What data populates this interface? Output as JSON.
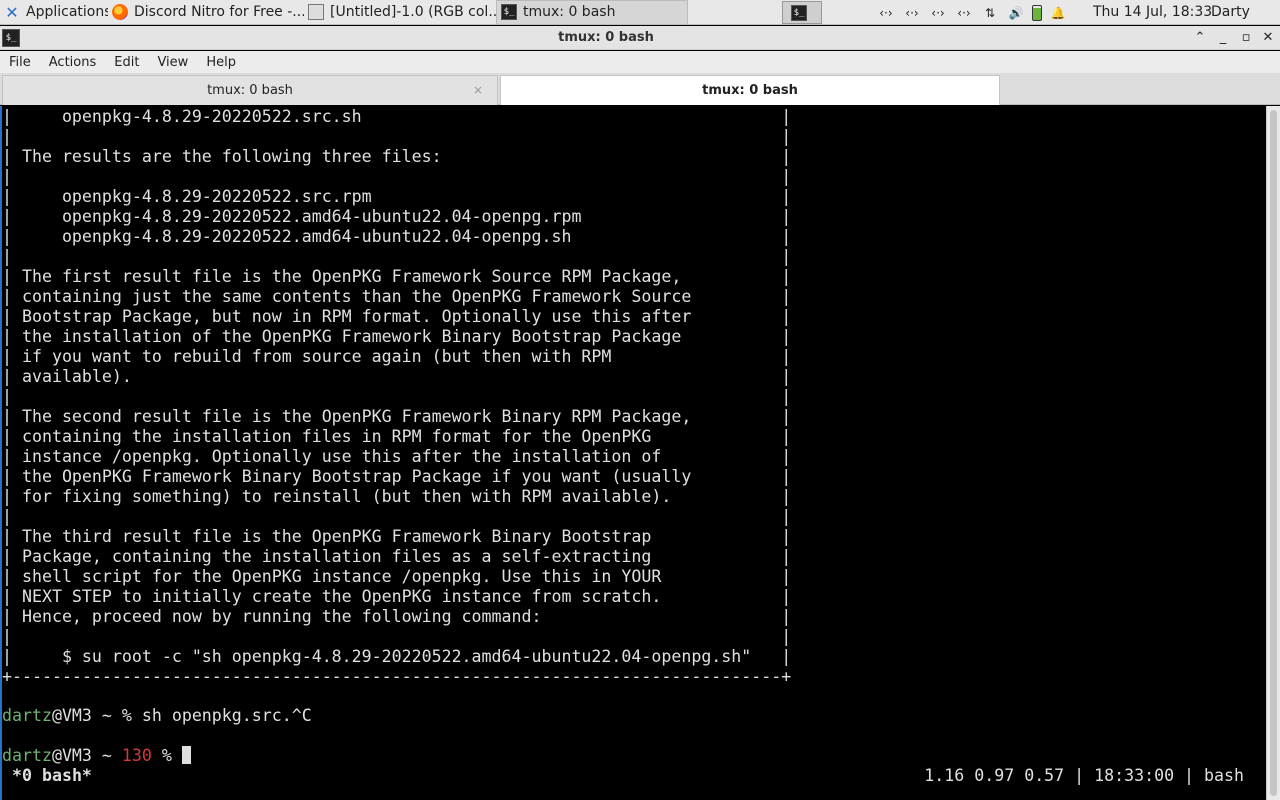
{
  "panel": {
    "apps_label": "Applications",
    "tasks": [
      {
        "label": "Discord Nitro for Free -...",
        "icon": "firefox-icon"
      },
      {
        "label": "[Untitled]-1.0 (RGB col...",
        "icon": "gimp-icon"
      },
      {
        "label": "tmux: 0 bash",
        "icon": "terminal-icon"
      }
    ],
    "tray": [
      "‹·›",
      "‹·›",
      "‹·›",
      "‹·›",
      "⇅",
      "🔊"
    ],
    "clock": "Thu 14 Jul, 18:33",
    "user": "Darty uwu"
  },
  "window": {
    "title": "tmux: 0 bash",
    "controls": {
      "minimize": "⌃",
      "maximize": "_",
      "restore": "▫",
      "close": "✕"
    }
  },
  "menu": [
    "File",
    "Actions",
    "Edit",
    "View",
    "Help"
  ],
  "tabs": [
    {
      "label": "tmux: 0 bash",
      "close": "×"
    },
    {
      "label": "tmux: 0 bash"
    }
  ],
  "terminal": {
    "lines": [
      "|     openpkg-4.8.29-20220522.src.sh                                          |",
      "|                                                                             |",
      "| The results are the following three files:                                  |",
      "|                                                                             |",
      "|     openpkg-4.8.29-20220522.src.rpm                                         |",
      "|     openpkg-4.8.29-20220522.amd64-ubuntu22.04-openpg.rpm                    |",
      "|     openpkg-4.8.29-20220522.amd64-ubuntu22.04-openpg.sh                     |",
      "|                                                                             |",
      "| The first result file is the OpenPKG Framework Source RPM Package,          |",
      "| containing just the same contents than the OpenPKG Framework Source         |",
      "| Bootstrap Package, but now in RPM format. Optionally use this after         |",
      "| the installation of the OpenPKG Framework Binary Bootstrap Package          |",
      "| if you want to rebuild from source again (but then with RPM                 |",
      "| available).                                                                 |",
      "|                                                                             |",
      "| The second result file is the OpenPKG Framework Binary RPM Package,         |",
      "| containing the installation files in RPM format for the OpenPKG             |",
      "| instance /openpkg. Optionally use this after the installation of            |",
      "| the OpenPKG Framework Binary Bootstrap Package if you want (usually         |",
      "| for fixing something) to reinstall (but then with RPM available).           |",
      "|                                                                             |",
      "| The third result file is the OpenPKG Framework Binary Bootstrap             |",
      "| Package, containing the installation files as a self-extracting             |",
      "| shell script for the OpenPKG instance /openpkg. Use this in YOUR            |",
      "| NEXT STEP to initially create the OpenPKG instance from scratch.            |",
      "| Hence, proceed now by running the following command:                        |",
      "|                                                                             |",
      "|     $ su root -c \"sh openpkg-4.8.29-20220522.amd64-ubuntu22.04-openpg.sh\"   |",
      "+-----------------------------------------------------------------------------+",
      ""
    ],
    "prompt1": {
      "user": "dartz",
      "rest": "@VM3 ~ % sh openpkg.src.^C"
    },
    "prompt2": {
      "user": "dartz",
      "mid": "@VM3 ~ ",
      "code": "130",
      "end": " % "
    },
    "status_left": "*0 bash*",
    "status_right": "1.16 0.97 0.57 | 18:33:00 | bash"
  }
}
